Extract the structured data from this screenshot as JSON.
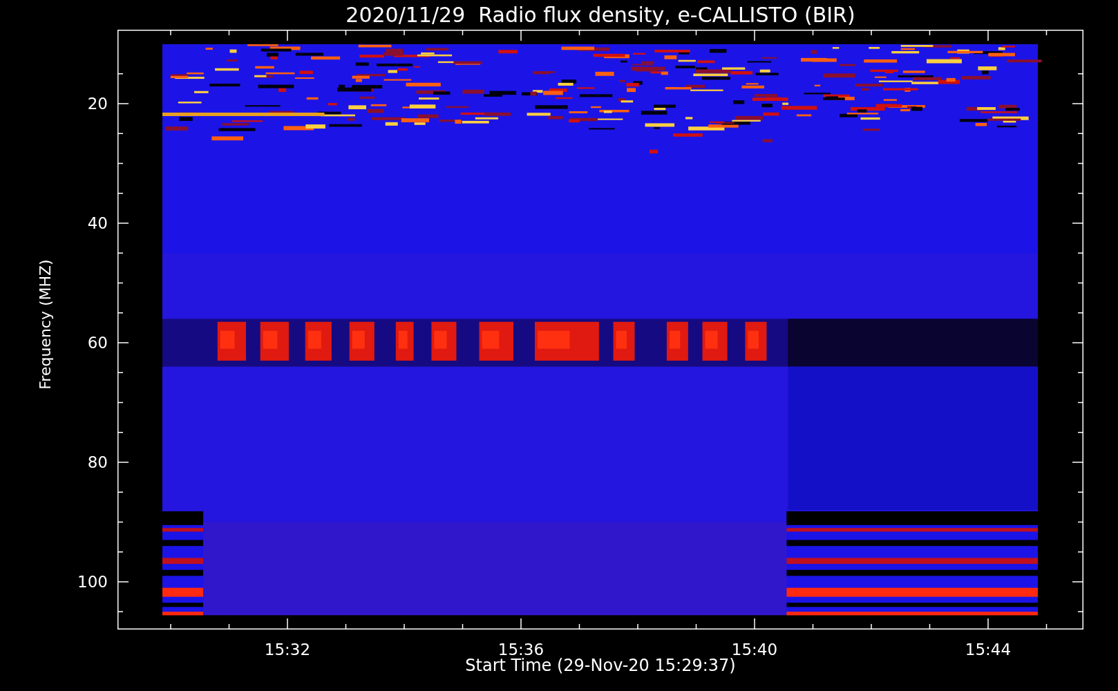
{
  "title": "2020/11/29  Radio flux density, e-CALLISTO (BIR)",
  "y_axis": {
    "label": "Frequency (MHZ)",
    "ticks": [
      "20",
      "40",
      "60",
      "80",
      "100"
    ]
  },
  "x_axis": {
    "label": "Start Time (29-Nov-20 15:29:37)",
    "ticks": [
      "15:32",
      "15:36",
      "15:40",
      "15:44"
    ]
  }
}
